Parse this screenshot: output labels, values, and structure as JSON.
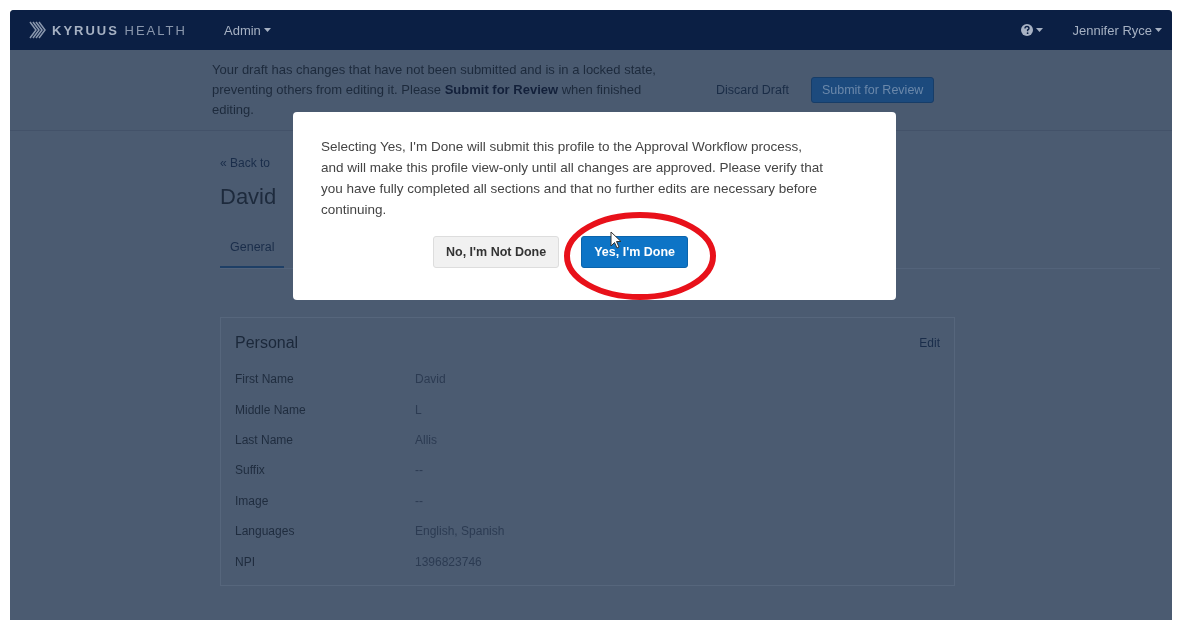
{
  "navbar": {
    "logo": "**KYRUUS** HEALTH",
    "menu": "Admin",
    "user": "Jennifer Ryce"
  },
  "banner": {
    "message": "Your draft has changes that have not been submitted and is in a locked state, preventing others from editing it. Please **Submit for Review** when finished editing.",
    "discard": "Discard Draft",
    "submit": "Submit for Review"
  },
  "page": {
    "back_link": "« Back to",
    "title": "David",
    "tabs": [
      {
        "label": "General",
        "selected": true
      }
    ]
  },
  "card": {
    "title": "Personal",
    "edit": "Edit",
    "fields": [
      {
        "label": "First Name",
        "value": "David"
      },
      {
        "label": "Middle Name",
        "value": "L"
      },
      {
        "label": "Last Name",
        "value": "Allis"
      },
      {
        "label": "Suffix",
        "value": "--"
      },
      {
        "label": "Image",
        "value": "--"
      },
      {
        "label": "Languages",
        "value": "English, Spanish"
      },
      {
        "label": "NPI",
        "value": "1396823746"
      }
    ]
  },
  "dialog": {
    "message": "Selecting Yes, I'm Done will submit this profile to the Approval Workflow process, and will make this profile view-only until all changes are approved. Please verify that you have fully completed all sections and that no further edits are necessary before continuing.",
    "buttons": [
      {
        "label": "No, I'm Not Done",
        "kind": "secondary"
      },
      {
        "label": "Yes, I'm Done",
        "kind": "primary",
        "highlighted": true
      }
    ]
  }
}
